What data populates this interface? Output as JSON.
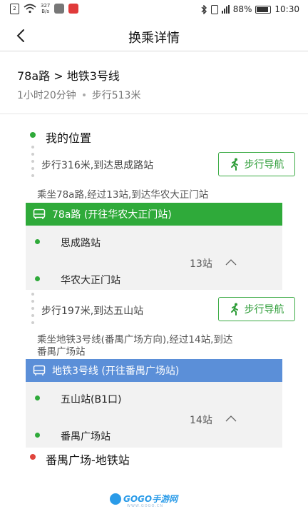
{
  "status_bar": {
    "net_speed_value": "327",
    "net_speed_unit": "B/s",
    "battery": "88%",
    "time": "10:30"
  },
  "header": {
    "title": "换乘详情"
  },
  "summary": {
    "route": "78a路 > 地铁3号线",
    "duration": "1小时20分钟",
    "walk": "步行513米"
  },
  "origin": "我的位置",
  "segments": {
    "walk1": {
      "text": "步行316米,到达思成路站",
      "nav_label": "步行导航"
    },
    "ride1": {
      "desc": "乘坐78a路,经过13站,到达华农大正门站",
      "line_label": "78a路 (开往华农大正门站)",
      "from_stop": "思成路站",
      "stop_count": "13站",
      "to_stop": "华农大正门站"
    },
    "walk2": {
      "text": "步行197米,到达五山站",
      "nav_label": "步行导航"
    },
    "ride2": {
      "desc_line1": "乘坐地铁3号线(番禺广场方向),经过14站,到达",
      "desc_line2": "番禺广场站",
      "line_label": "地铁3号线 (开往番禺广场站)",
      "from_stop": "五山站(B1口)",
      "stop_count": "14站",
      "to_stop": "番禺广场站"
    }
  },
  "destination": "番禺广场-地铁站",
  "watermark": {
    "brand": "GOGO手游网",
    "url": "WWW.GOGO.CN"
  },
  "colors": {
    "green": "#2faa3a",
    "blue": "#5b8fd8",
    "red": "#e0443c"
  }
}
